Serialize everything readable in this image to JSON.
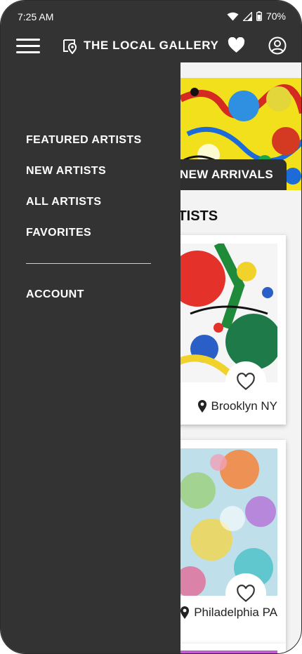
{
  "status_bar": {
    "time": "7:25 AM",
    "battery": "70%"
  },
  "header": {
    "title": "THE LOCAL GALLERY"
  },
  "drawer": {
    "items": [
      "FEATURED ARTISTS",
      "NEW ARTISTS",
      "ALL ARTISTS",
      "FAVORITES"
    ],
    "account": "ACCOUNT"
  },
  "content": {
    "banner_button": "NEW ARRIVALS",
    "section_title": "RTISTS",
    "cards": [
      {
        "location": "Brooklyn NY"
      },
      {
        "location": "Philadelphia PA"
      }
    ]
  },
  "colors": {
    "bar": "#333333",
    "drawer": "#333333",
    "background": "#f3f3f3"
  }
}
